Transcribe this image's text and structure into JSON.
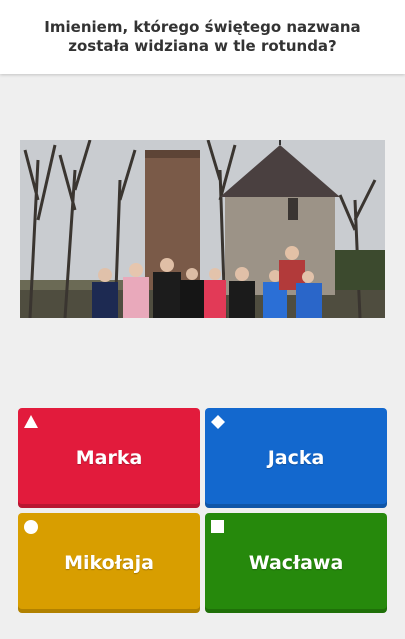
{
  "question": {
    "text": "Imieniem, którego świętego nazwana została widziana w tle rotunda?"
  },
  "image": {
    "subject": "photo"
  },
  "answers": [
    {
      "label": "Marka",
      "shape": "triangle-icon",
      "color": "#e21b3c"
    },
    {
      "label": "Jacka",
      "shape": "diamond-icon",
      "color": "#1368ce"
    },
    {
      "label": "Mikołaja",
      "shape": "circle-icon",
      "color": "#d89e00"
    },
    {
      "label": "Wacława",
      "shape": "square-icon",
      "color": "#26890c"
    }
  ]
}
